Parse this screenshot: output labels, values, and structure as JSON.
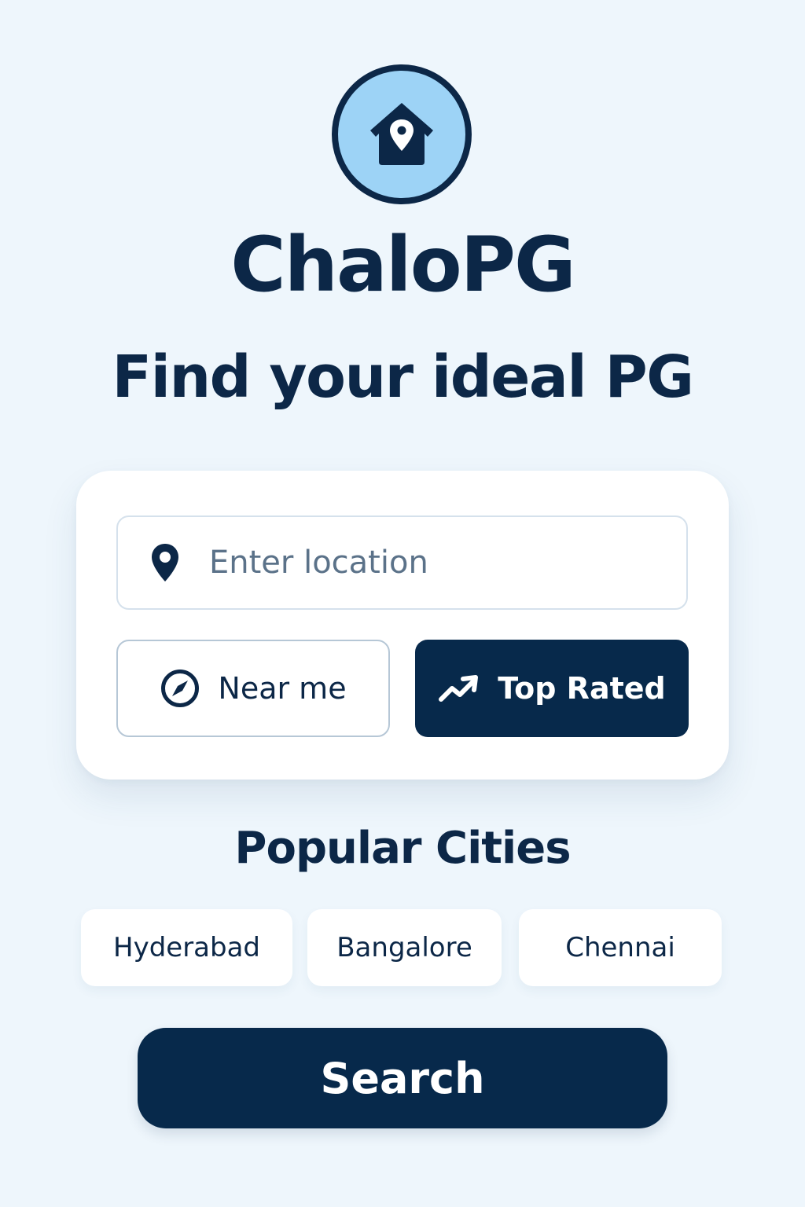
{
  "brand": {
    "logo_icon": "house-pin-icon",
    "name": "ChaloPG"
  },
  "headline": "Find your ideal PG",
  "search_card": {
    "location_input": {
      "icon": "map-pin-icon",
      "placeholder": "Enter location",
      "value": ""
    },
    "near_me": {
      "icon": "compass-icon",
      "label": "Near me"
    },
    "top_rated": {
      "icon": "trending-up-icon",
      "label": "Top Rated"
    }
  },
  "popular_cities": {
    "title": "Popular Cities",
    "cities": [
      "Hyderabad",
      "Bangalore",
      "Chennai"
    ]
  },
  "search_button": {
    "label": "Search"
  },
  "colors": {
    "background": "#eef6fc",
    "primary": "#07294b",
    "logo_fill": "#9dd3f6",
    "card": "#ffffff"
  }
}
